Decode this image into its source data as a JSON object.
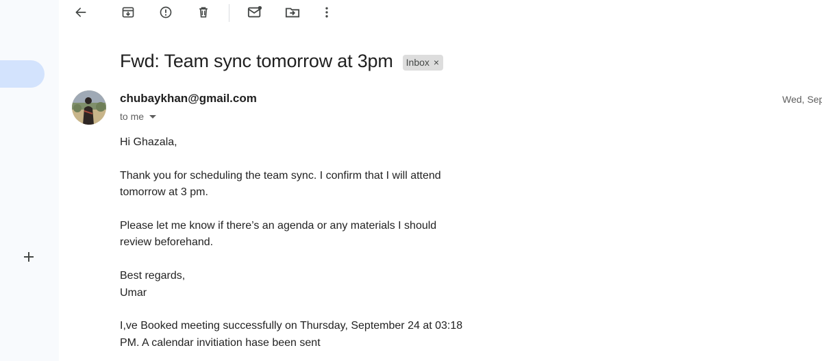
{
  "toolbar": {
    "icons": [
      "back-arrow-icon",
      "archive-icon",
      "report-spam-icon",
      "delete-icon",
      "mark-unread-icon",
      "move-to-icon",
      "more-vert-icon"
    ]
  },
  "email": {
    "subject": "Fwd: Team sync tomorrow at 3pm",
    "label_chip": "Inbox",
    "label_remove": "×",
    "sender": "chubaykhan@gmail.com",
    "recipient": "to me",
    "date": "Wed, Sep",
    "body": {
      "greeting": "Hi Ghazala,",
      "para1_line1": "Thank you for scheduling the team sync. I confirm that I will attend",
      "para1_line2": "tomorrow at 3 pm.",
      "para2_line1": "Please let me know if there’s an agenda or any materials I should",
      "para2_line2": "review beforehand.",
      "closing": "Best regards,",
      "signature": "Umar",
      "para3_line1": "I,ve Booked meeting successfully on Thursday, September 24 at 03:18",
      "para3_line2": "PM. A calendar invitiation hase been sent"
    }
  },
  "colors": {
    "accent_pill": "#d3e3fd",
    "chip_bg": "#dddddd",
    "page_bg": "#ffffff",
    "rail_bg": "#f8fafd"
  }
}
